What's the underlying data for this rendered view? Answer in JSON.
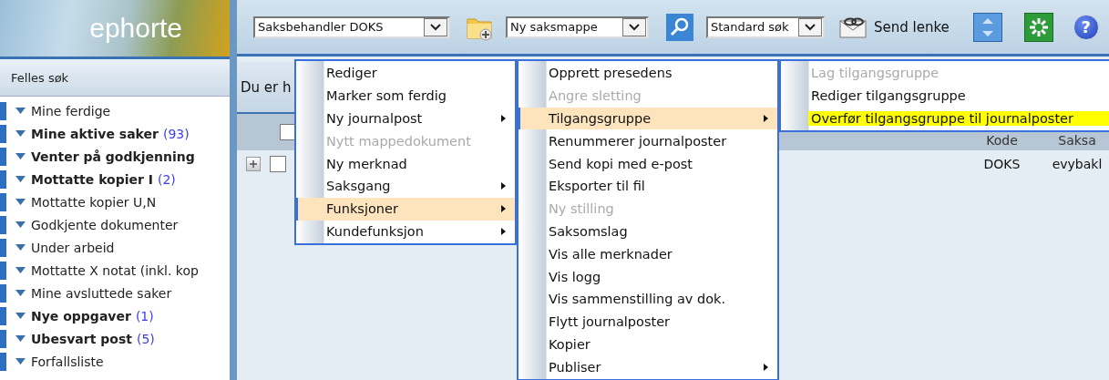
{
  "logo": "ephorte",
  "sidebar": {
    "title": "Felles søk",
    "items": [
      {
        "label": "Mine ferdige",
        "bold": false
      },
      {
        "label": "Mine aktive saker",
        "bold": true,
        "count": "(93)"
      },
      {
        "label": "Venter på godkjenning",
        "bold": true
      },
      {
        "label": "Mottatte kopier I",
        "bold": true,
        "count": "(2)"
      },
      {
        "label": "Mottatte kopier U,N",
        "bold": false
      },
      {
        "label": "Godkjente dokumenter",
        "bold": false
      },
      {
        "label": "Under arbeid",
        "bold": false
      },
      {
        "label": "Mottatte X notat (inkl. kop",
        "bold": false
      },
      {
        "label": "Mine avsluttede saker",
        "bold": false
      },
      {
        "label": "Nye oppgaver",
        "bold": true,
        "count": "(1)"
      },
      {
        "label": "Ubesvart post",
        "bold": true,
        "count": "(5)"
      },
      {
        "label": "Forfallsliste",
        "bold": false
      }
    ]
  },
  "toolbar": {
    "user_dropdown": "Saksbehandler DOKS",
    "new_dropdown": "Ny saksmappe",
    "search_dropdown": "Standard søk",
    "send_link": "Send lenke",
    "help": "?"
  },
  "content": {
    "header": "Du er h",
    "select_all_checked": false,
    "columns": [
      "Kode",
      "Saksa"
    ],
    "rows": [
      {
        "expanded": false,
        "checked": false,
        "cells": [
          "DOKS",
          "evybakl"
        ]
      }
    ]
  },
  "menus": [
    {
      "items": [
        {
          "label": "Rediger",
          "disabled": false,
          "selected": false,
          "submenu": false,
          "marked": false
        },
        {
          "label": "Marker som ferdig",
          "disabled": false,
          "selected": false,
          "submenu": false,
          "marked": false
        },
        {
          "label": "Ny journalpost",
          "disabled": false,
          "selected": false,
          "submenu": true,
          "marked": false
        },
        {
          "label": "Nytt mappedokument",
          "disabled": true,
          "selected": false,
          "submenu": false,
          "marked": false
        },
        {
          "label": "Ny merknad",
          "disabled": false,
          "selected": false,
          "submenu": false,
          "marked": false
        },
        {
          "label": "Saksgang",
          "disabled": false,
          "selected": false,
          "submenu": true,
          "marked": false
        },
        {
          "label": "Funksjoner",
          "disabled": false,
          "selected": true,
          "submenu": true,
          "marked": false
        },
        {
          "label": "Kundefunksjon",
          "disabled": false,
          "selected": false,
          "submenu": true,
          "marked": false
        }
      ]
    },
    {
      "items": [
        {
          "label": "Opprett presedens",
          "disabled": false,
          "selected": false,
          "submenu": false,
          "marked": false
        },
        {
          "label": "Angre sletting",
          "disabled": true,
          "selected": false,
          "submenu": false,
          "marked": false
        },
        {
          "label": "Tilgangsgruppe",
          "disabled": false,
          "selected": true,
          "submenu": true,
          "marked": false
        },
        {
          "label": "Renummerer journalposter",
          "disabled": false,
          "selected": false,
          "submenu": false,
          "marked": false
        },
        {
          "label": "Send kopi med e-post",
          "disabled": false,
          "selected": false,
          "submenu": false,
          "marked": false
        },
        {
          "label": "Eksporter til fil",
          "disabled": false,
          "selected": false,
          "submenu": false,
          "marked": false
        },
        {
          "label": "Ny stilling",
          "disabled": true,
          "selected": false,
          "submenu": false,
          "marked": false
        },
        {
          "label": "Saksomslag",
          "disabled": false,
          "selected": false,
          "submenu": false,
          "marked": false
        },
        {
          "label": "Vis alle merknader",
          "disabled": false,
          "selected": false,
          "submenu": false,
          "marked": false
        },
        {
          "label": "Vis logg",
          "disabled": false,
          "selected": false,
          "submenu": false,
          "marked": false
        },
        {
          "label": "Vis sammenstilling av dok.",
          "disabled": false,
          "selected": false,
          "submenu": false,
          "marked": false
        },
        {
          "label": "Flytt journalposter",
          "disabled": false,
          "selected": false,
          "submenu": false,
          "marked": false
        },
        {
          "label": "Kopier",
          "disabled": false,
          "selected": false,
          "submenu": false,
          "marked": false
        },
        {
          "label": "Publiser",
          "disabled": false,
          "selected": false,
          "submenu": true,
          "marked": false
        }
      ]
    },
    {
      "items": [
        {
          "label": "Lag tilgangsgruppe",
          "disabled": true,
          "selected": false,
          "submenu": false,
          "marked": false
        },
        {
          "label": "Rediger tilgangsgruppe",
          "disabled": false,
          "selected": false,
          "submenu": false,
          "marked": false
        },
        {
          "label": "Overfør tilgangsgruppe til journalposter",
          "disabled": false,
          "selected": false,
          "submenu": false,
          "marked": true
        }
      ]
    }
  ]
}
